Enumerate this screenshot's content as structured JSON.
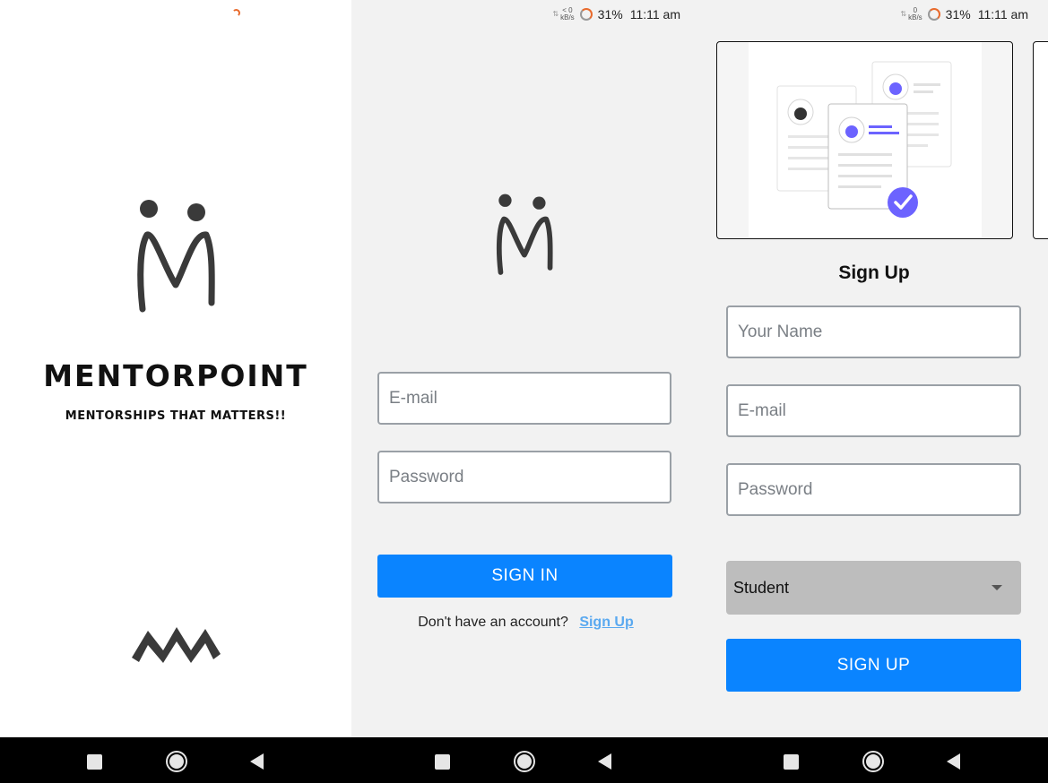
{
  "splash": {
    "brand_name": "MENTORPOINT",
    "tagline": "MENTORSHIPS THAT MATTERS!!",
    "logo_icon": "mentorpoint-m-logo-icon",
    "footer_icon": "mm-zigzag-logo-icon"
  },
  "status_bar": {
    "net_speed_value": "< 0",
    "net_speed_unit": "kB/s",
    "net_speed_value_2": "0",
    "battery": "31%",
    "time": "11:11 am",
    "accent": "#e86a2c"
  },
  "signin": {
    "email_placeholder": "E-mail",
    "password_placeholder": "Password",
    "button_label": "SIGN IN",
    "footer_text": "Don't have an account?",
    "signup_link": "Sign Up"
  },
  "signup": {
    "title": "Sign Up",
    "name_placeholder": "Your Name",
    "email_placeholder": "E-mail",
    "password_placeholder": "Password",
    "role_selected": "Student",
    "button_label": "SIGN UP",
    "illustration": "profile-cards-verified-illustration"
  },
  "colors": {
    "primary": "#0a84ff",
    "link": "#5aa9f0",
    "illustration_accent": "#6c63ff"
  },
  "navigation": [
    "recents-icon",
    "home-icon",
    "back-icon"
  ]
}
